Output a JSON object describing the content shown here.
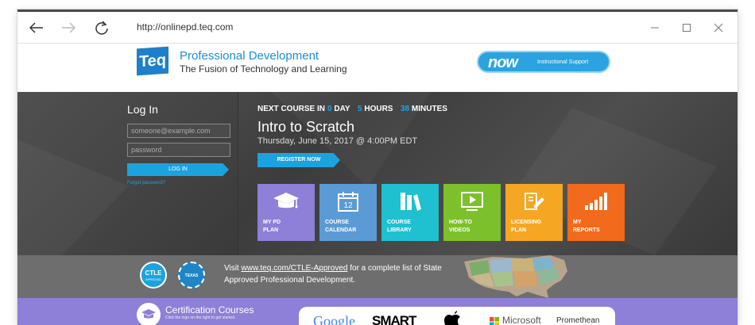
{
  "browser": {
    "url": "http://onlinepd.teq.com"
  },
  "header": {
    "logo_text": "Teq",
    "title": "Professional Development",
    "subtitle": "The Fusion of Technology and Learning",
    "now_badge": {
      "word": "now",
      "tag": "Instructional Support"
    }
  },
  "login": {
    "title": "Log In",
    "email_placeholder": "someone@example.com",
    "password_placeholder": "password",
    "button_label": "LOG IN",
    "forgot_label": "Forgot password?"
  },
  "countdown": {
    "label": "NEXT COURSE IN",
    "days_value": "0",
    "days_unit": "DAY",
    "hours_value": "5",
    "hours_unit": "HOURS",
    "minutes_value": "38",
    "minutes_unit": "MINUTES"
  },
  "course": {
    "title": "Intro to Scratch",
    "date": "Thursday, June 15, 2017 @ 4:00PM EDT",
    "register_label": "REGISTER NOW"
  },
  "tiles": [
    {
      "line1": "MY PD",
      "line2": "PLAN",
      "icon": "graduation-cap-icon",
      "color": "#8e7fd8"
    },
    {
      "line1": "COURSE",
      "line2": "CALENDAR",
      "icon": "calendar-icon",
      "color": "#5b9bd5",
      "calendar_day": "12"
    },
    {
      "line1": "COURSE",
      "line2": "LIBRARY",
      "icon": "books-icon",
      "color": "#1fc0cf"
    },
    {
      "line1": "HOW-TO",
      "line2": "VIDEOS",
      "icon": "video-icon",
      "color": "#7cc12b"
    },
    {
      "line1": "LICENSING",
      "line2": "PLAN",
      "icon": "pencil-doc-icon",
      "color": "#f5a623"
    },
    {
      "line1": "MY",
      "line2": "REPORTS",
      "icon": "bar-chart-icon",
      "color": "#f26a1b"
    }
  ],
  "ctle": {
    "seal1_text": "CTLE",
    "seal1_sub": "APPROVED",
    "seal2_text": "TEXAS",
    "text_before": "Visit ",
    "link": "www.teq.com/CTLE-Approved",
    "text_after": " for a complete list of State Approved Professional Development."
  },
  "certification": {
    "title": "Certification Courses",
    "subtitle": "Click the logo on the right to get started.",
    "partners": [
      "Google",
      "SMART",
      "Microsoft",
      "Promethean"
    ]
  },
  "colors": {
    "accent_blue": "#1ba3e0",
    "brand_blue": "#1a8fd6",
    "cert_purple": "#8e7fd8"
  }
}
